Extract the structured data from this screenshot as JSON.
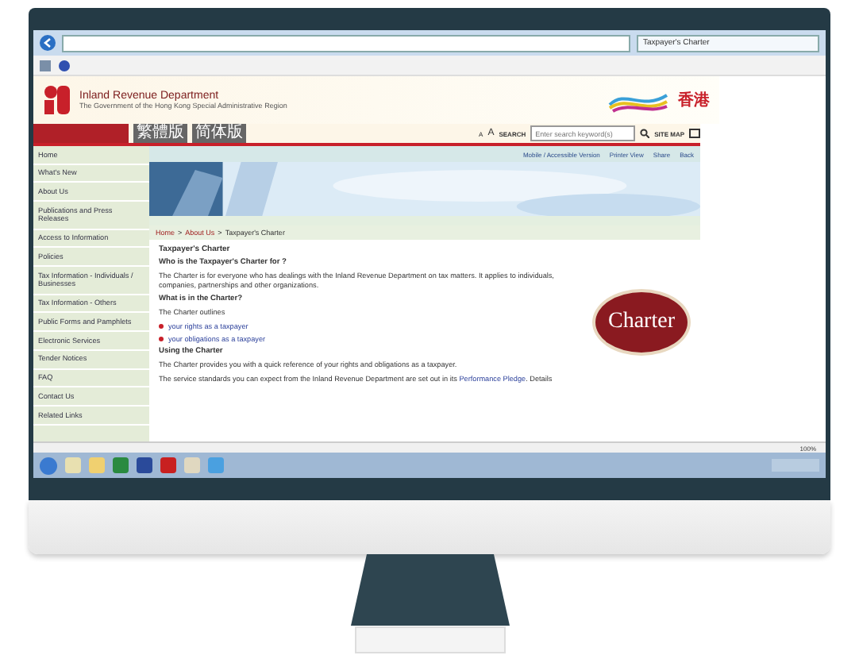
{
  "browser": {
    "tab_title": "Taxpayer's Charter"
  },
  "header": {
    "title": "Inland Revenue Department",
    "subtitle": "The Government of the Hong Kong Special Administrative Region",
    "brand": "香港"
  },
  "nav": {
    "languages": [
      "繁體版",
      "简体版"
    ],
    "font_sizes": [
      "A",
      "A"
    ],
    "search_label": "SEARCH",
    "search_placeholder": "Enter search keyword(s)",
    "site_map": "SITE MAP"
  },
  "sidebar": {
    "items": [
      "Home",
      "What's New",
      "About Us",
      "Publications and Press Releases",
      "Access to Information",
      "Policies",
      "Tax Information - Individuals / Businesses",
      "Tax Information - Others",
      "Public Forms and Pamphlets",
      "Electronic Services",
      "Tender Notices",
      "FAQ",
      "Contact Us",
      "Related Links"
    ]
  },
  "tools": [
    "Mobile / Accessible Version",
    "Printer View",
    "Share",
    "Back"
  ],
  "breadcrumb": {
    "separator": ">",
    "items": [
      "Home",
      "About Us",
      "Taxpayer's Charter"
    ]
  },
  "content": {
    "title": "Taxpayer's Charter",
    "sections": [
      {
        "heading": "Who is the Taxpayer's Charter for ?",
        "paragraphs": [
          {
            "text": "The Charter is for everyone who has dealings with the Inland Revenue Department on tax matters. It applies to individuals, companies, partnerships and other organizations."
          }
        ]
      },
      {
        "heading": "What is in the Charter?",
        "paragraphs": [
          {
            "text": "The Charter outlines"
          }
        ],
        "links": [
          "your rights as a taxpayer",
          "your obligations as a taxpayer"
        ]
      },
      {
        "heading": "Using the Charter",
        "paragraphs": [
          {
            "text": "The Charter provides you with a quick reference of your rights and obligations as a taxpayer."
          },
          {
            "text": "The service standards you can expect from the Inland Revenue Department are set out in its",
            "link": "Performance Pledge",
            "tail": ". Details"
          }
        ]
      }
    ],
    "badge": "Charter"
  },
  "status_bar": {
    "zoom": "100%"
  }
}
